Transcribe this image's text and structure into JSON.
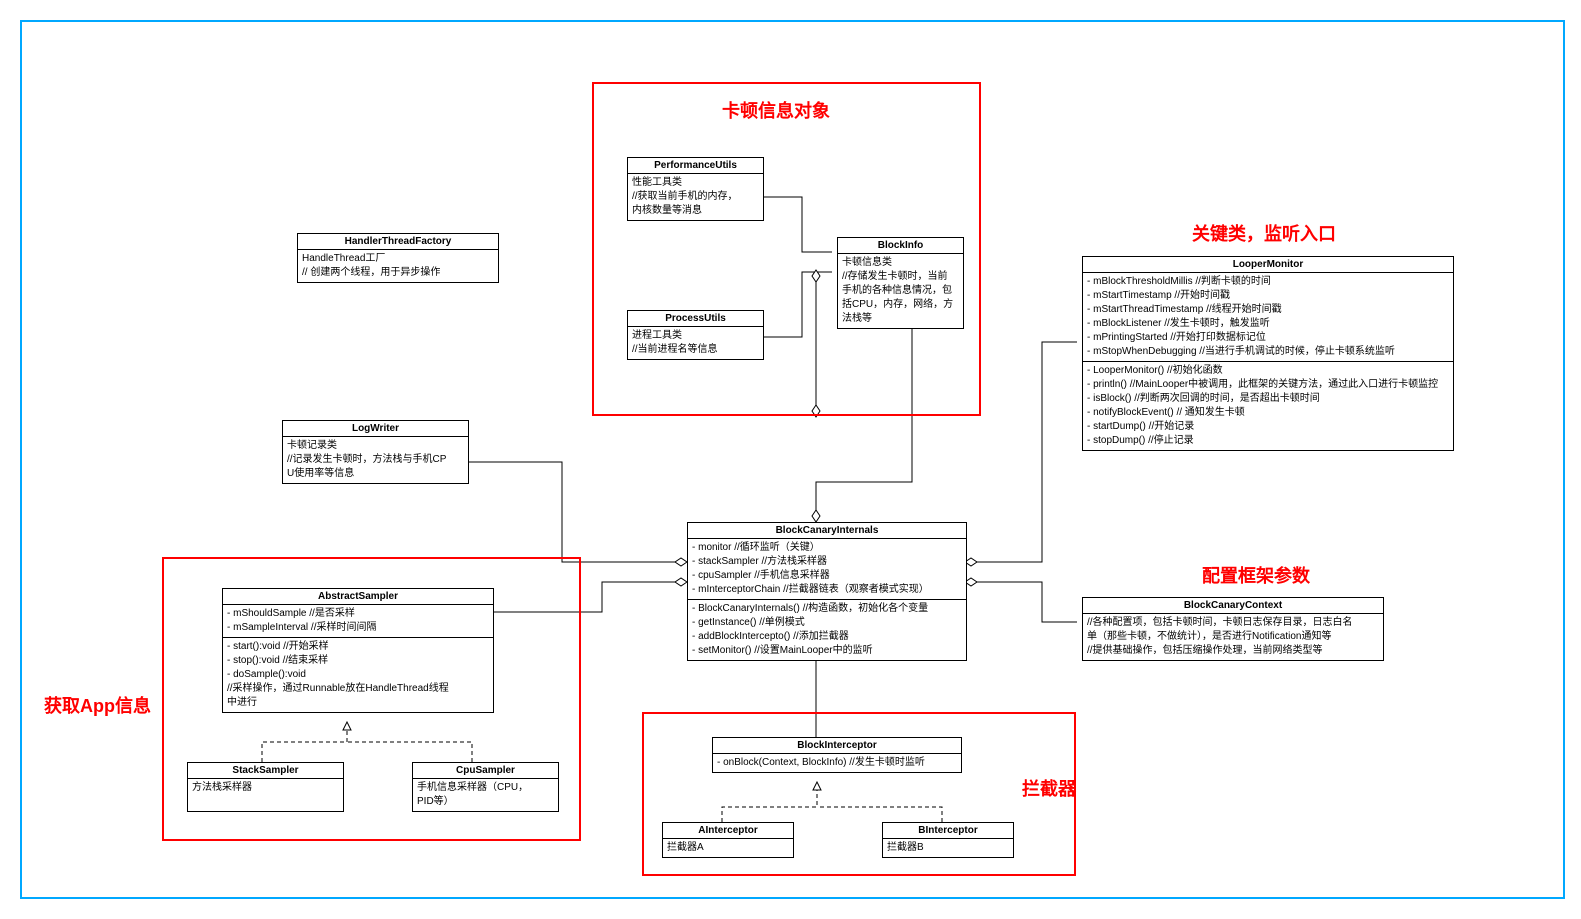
{
  "groups": {
    "blockinfo": {
      "label": "卡顿信息对象"
    },
    "looper": {
      "label": "关键类，监听入口"
    },
    "context": {
      "label": "配置框架参数"
    },
    "sampler": {
      "label": "获取App信息"
    },
    "interceptor": {
      "label": "拦截器"
    }
  },
  "classes": {
    "HandlerThreadFactory": {
      "title": "HandlerThreadFactory",
      "rows": [
        "HandleThread工厂",
        "// 创建两个线程，用于异步操作"
      ]
    },
    "PerformanceUtils": {
      "title": "PerformanceUtils",
      "rows": [
        "性能工具类",
        "//获取当前手机的内存，",
        "内核数量等消息"
      ]
    },
    "ProcessUtils": {
      "title": "ProcessUtils",
      "rows": [
        "进程工具类",
        "//当前进程名等信息"
      ]
    },
    "BlockInfo": {
      "title": "BlockInfo",
      "rows": [
        "卡顿信息类",
        "//存储发生卡顿时，当前",
        "手机的各种信息情况，包",
        "括CPU，内存，网络，方",
        "法栈等"
      ]
    },
    "LogWriter": {
      "title": "LogWriter",
      "rows": [
        "卡顿记录类",
        "//记录发生卡顿时，方法栈与手机CP",
        "U使用率等信息"
      ]
    },
    "LooperMonitor": {
      "title": "LooperMonitor",
      "attrs": [
        "- mBlockThresholdMillis //判断卡顿的时间",
        "- mStartTimestamp //开始时间戳",
        "- mStartThreadTimestamp //线程开始时间戳",
        "- mBlockListener //发生卡顿时，触发监听",
        "- mPrintingStarted //开始打印数据标记位",
        "- mStopWhenDebugging //当进行手机调试的时候，停止卡顿系统监听"
      ],
      "ops": [
        "- LooperMonitor() //初始化函数",
        "- println() //MainLooper中被调用，此框架的关键方法，通过此入口进行卡顿监控",
        "- isBlock() //判断两次回调的时间，是否超出卡顿时间",
        "- notifyBlockEvent() // 通知发生卡顿",
        "- startDump() //开始记录",
        "- stopDump() //停止记录"
      ]
    },
    "BlockCanaryInternals": {
      "title": "BlockCanaryInternals",
      "attrs": [
        "- monitor //循环监听（关键）",
        "- stackSampler //方法栈采样器",
        "- cpuSampler //手机信息采样器",
        "- mInterceptorChain //拦截器链表（观察者模式实现）"
      ],
      "ops": [
        "- BlockCanaryInternals() //构造函数，初始化各个变量",
        "- getInstance() //单例模式",
        "- addBlockIntercepto() //添加拦截器",
        "- setMonitor() //设置MainLooper中的监听"
      ]
    },
    "BlockCanaryContext": {
      "title": "BlockCanaryContext",
      "rows": [
        "//各种配置项，包括卡顿时间，卡顿日志保存目录，日志白名",
        "单（那些卡顿，不做统计），是否进行Notification通知等",
        "//提供基础操作，包括压缩操作处理，当前网络类型等"
      ]
    },
    "AbstractSampler": {
      "title": "AbstractSampler",
      "attrs": [
        "- mShouldSample //是否采样",
        "- mSampleInterval //采样时间间隔"
      ],
      "ops": [
        "- start():void //开始采样",
        "- stop():void //结束采样",
        "- doSample():void",
        "//采样操作，通过Runnable放在HandleThread线程",
        "中进行"
      ]
    },
    "StackSampler": {
      "title": "StackSampler",
      "rows": [
        "方法栈采样器"
      ]
    },
    "CpuSampler": {
      "title": "CpuSampler",
      "rows": [
        "手机信息采样器（CPU，",
        "PID等）"
      ]
    },
    "BlockInterceptor": {
      "title": "BlockInterceptor",
      "rows": [
        "- onBlock(Context, BlockInfo) //发生卡顿时监听"
      ]
    },
    "AInterceptor": {
      "title": "AInterceptor",
      "rows": [
        "拦截器A"
      ]
    },
    "BInterceptor": {
      "title": "BInterceptor",
      "rows": [
        "拦截器B"
      ]
    }
  }
}
